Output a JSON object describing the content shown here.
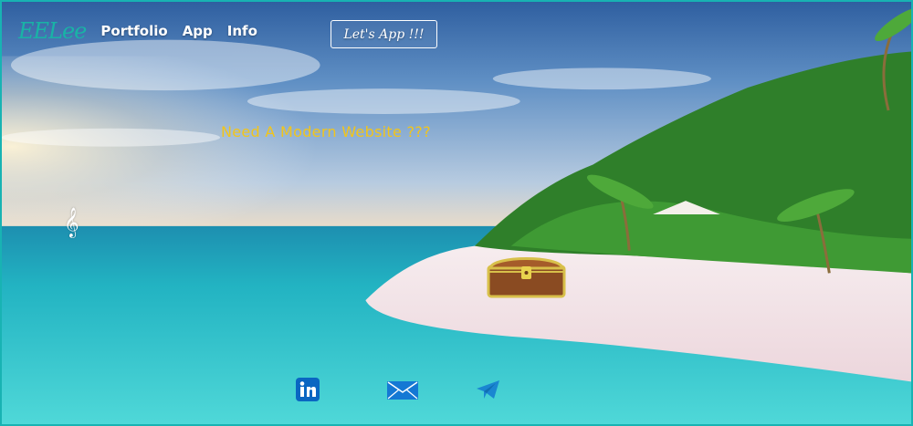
{
  "nav": {
    "logo": "EELee",
    "links": [
      {
        "label": "Portfolio"
      },
      {
        "label": "App"
      },
      {
        "label": "Info"
      }
    ],
    "cta_label": "Let's App !!!"
  },
  "hero": {
    "headline": "Need A Modern Website ???",
    "music_glyph": "𝄞"
  },
  "social": [
    {
      "icon": "linkedin-icon",
      "color": "#0a66c2"
    },
    {
      "icon": "mail-icon",
      "color": "#1478d4"
    },
    {
      "icon": "telegram-icon",
      "color": "#1a86d1"
    }
  ],
  "colors": {
    "border": "#18b3b3",
    "logo": "#19b3a6",
    "headline": "#f2c51a",
    "nav_text": "#ffffff",
    "sand": "#f1e3e6",
    "sea": "#2bbfcc",
    "sky": "#4a7bb7"
  }
}
